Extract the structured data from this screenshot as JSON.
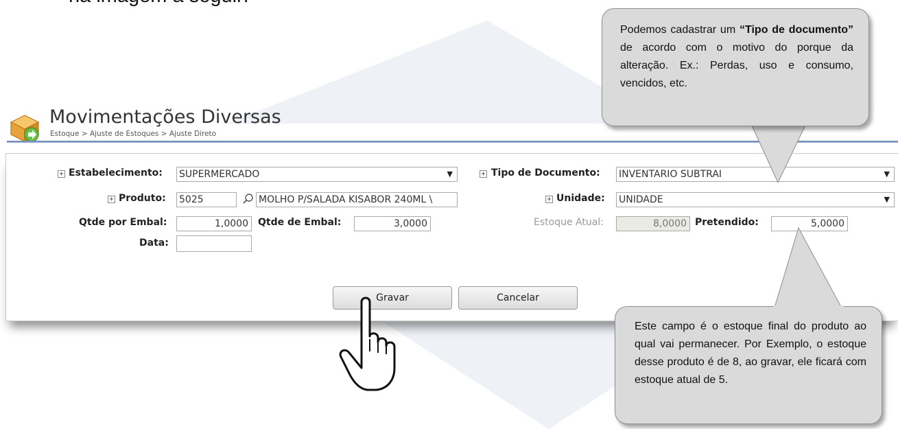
{
  "doc": {
    "partial_text": "na imagem a seguir:"
  },
  "app": {
    "title": "Movimentações Diversas",
    "breadcrumb": "Estoque > Ajuste de Estoques > Ajuste Direto"
  },
  "form": {
    "estabelecimento_label": "Estabelecimento:",
    "estabelecimento_value": "SUPERMERCADO",
    "produto_label": "Produto:",
    "produto_code": "5025",
    "produto_desc": "MOLHO P/SALADA KISABOR 240ML \\",
    "qtde_por_embal_label": "Qtde por Embal:",
    "qtde_por_embal_value": "1,0000",
    "qtde_de_embal_label": "Qtde de Embal:",
    "qtde_de_embal_value": "3,0000",
    "data_label": "Data:",
    "data_value": "",
    "tipo_documento_label": "Tipo de Documento:",
    "tipo_documento_value": "INVENTARIO SUBTRAI",
    "unidade_label": "Unidade:",
    "unidade_value": "UNIDADE",
    "estoque_atual_label": "Estoque Atual:",
    "estoque_atual_value": "8,0000",
    "pretendido_label": "Pretendido:",
    "pretendido_value": "5,0000"
  },
  "buttons": {
    "gravar": "Gravar",
    "cancelar": "Cancelar"
  },
  "callouts": {
    "top": {
      "pre": "Podemos cadastrar um ",
      "bold": "“Tipo de documento”",
      "post": " de acordo com o motivo do porque da alteração. Ex.: Perdas, uso e consumo, vencidos, etc."
    },
    "bottom": {
      "text": "Este campo é o estoque final do produto ao qual vai permanecer. Por Exemplo, o estoque desse produto é de 8, ao gravar, ele ficará com estoque atual de 5."
    }
  },
  "icons": {
    "app": "box-arrow-icon",
    "expand": "plus-box-icon",
    "lookup": "magnifier-icon",
    "dropdown": "triangle-down-icon",
    "cursor": "hand-pointer-icon"
  }
}
